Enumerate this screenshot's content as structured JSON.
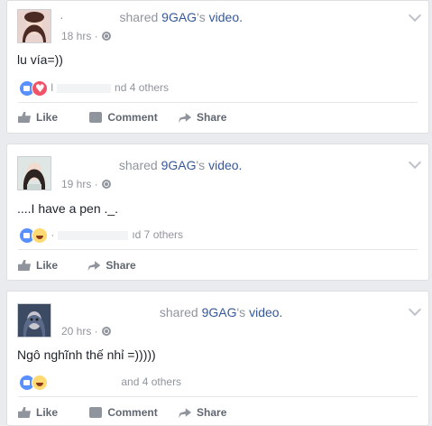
{
  "posts": [
    {
      "author": "·",
      "shared_text": "shared",
      "page": "9GAG",
      "possessive": "'s",
      "object": "video.",
      "time": "18 hrs ·",
      "text": "lu vía=))",
      "reaction_suffix": "nd 4 others",
      "reaction_prefix": "l",
      "actions": [
        "Like",
        "Comment",
        "Share"
      ]
    },
    {
      "author": "",
      "shared_text": "shared",
      "page": "9GAG",
      "possessive": "'s",
      "object": "video.",
      "time": "19 hrs ·",
      "text": "....I have a pen ._.",
      "reaction_suffix": "ıd 7 others",
      "reaction_prefix": "·",
      "actions": [
        "Like",
        "Share"
      ]
    },
    {
      "author": "",
      "shared_text": "shared",
      "page": "9GAG",
      "possessive": "'s",
      "object": "video.",
      "time": "20 hrs ·",
      "text": "Ngô nghĩnh thế nhỉ =)))))",
      "reaction_suffix": "and 4 others",
      "reaction_prefix": "",
      "actions": [
        "Like",
        "Comment",
        "Share"
      ]
    }
  ],
  "icons": {
    "like_reaction": "thumbs-up-icon",
    "love_reaction": "heart-icon",
    "haha_reaction": "laughing-face-icon",
    "privacy": "globe-icon",
    "options": "chevron-down-icon"
  },
  "colors": {
    "link": "#365899",
    "muted": "#90949c",
    "like": "#5890ff",
    "love": "#f25268",
    "haha": "#ffd972",
    "background": "#e9ebee"
  }
}
